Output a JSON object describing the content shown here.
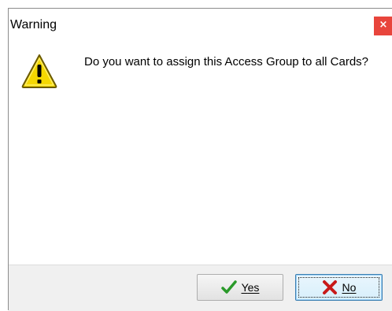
{
  "window": {
    "title": "Warning",
    "close_glyph": "×"
  },
  "dialog": {
    "icon": "warning-icon",
    "message": "Do you want to assign this Access Group to all Cards?"
  },
  "buttons": {
    "yes_label": "Yes",
    "yes_icon": "checkmark-icon",
    "no_label": "No",
    "no_icon": "x-icon"
  },
  "colors": {
    "close_button": "#e8453c",
    "warning_fill": "#f5d800",
    "check": "#2a9a2a",
    "x_mark": "#c81a1a",
    "footer_bg": "#f0f0f0"
  }
}
